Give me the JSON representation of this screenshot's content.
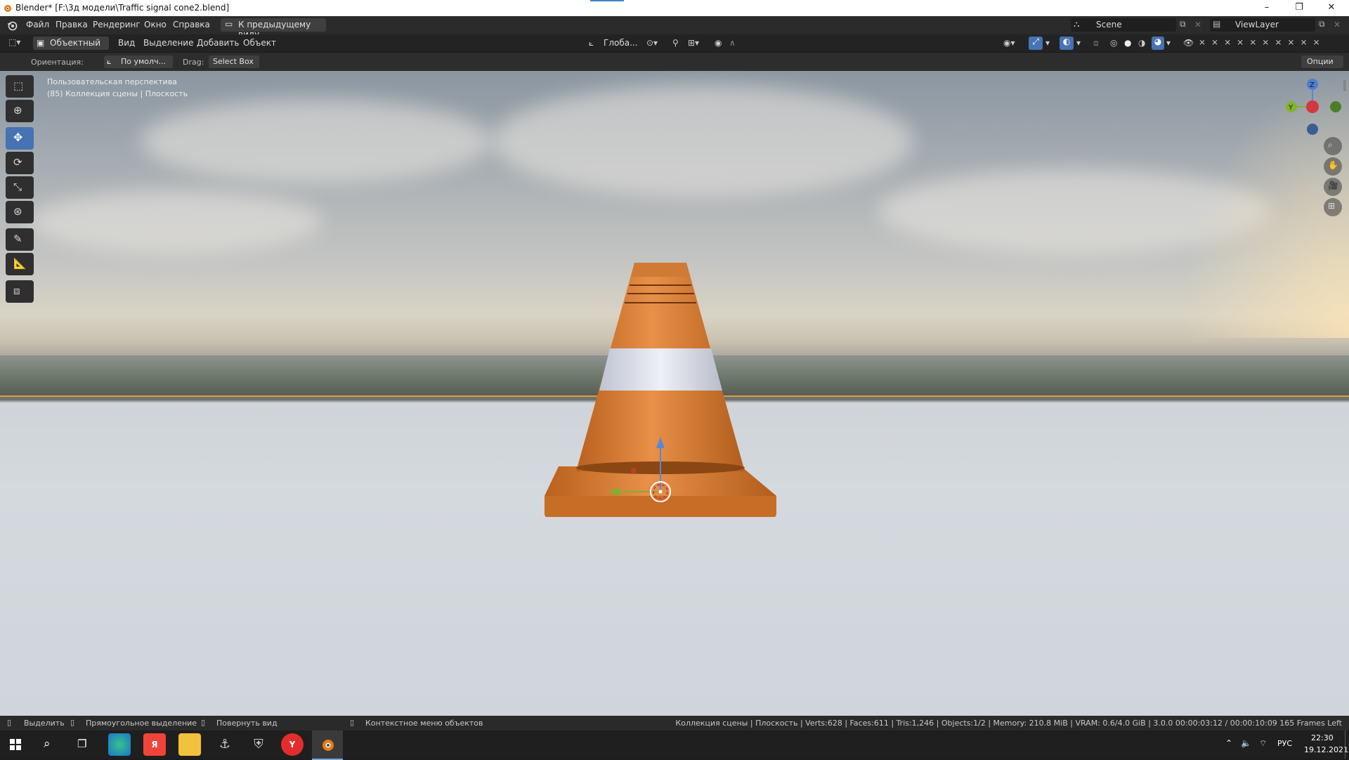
{
  "window": {
    "title": "Blender* [F:\\3д модели\\Traffic signal cone2.blend]",
    "minimize": "–",
    "maximize": "❐",
    "close": "✕"
  },
  "menu": {
    "items": [
      "Файл",
      "Правка",
      "Рендеринг",
      "Окно",
      "Справка"
    ],
    "back_button": "К предыдущему виду",
    "scene_label": "Scene",
    "viewlayer_label": "ViewLayer"
  },
  "header": {
    "mode": "Объектный ...",
    "menus": [
      "Вид",
      "Выделение",
      "Добавить",
      "Объект"
    ],
    "transform": "Глоба..."
  },
  "tool_options": {
    "orientation_label": "Ориентация:",
    "orientation_value": "По умолч...",
    "drag_label": "Drag:",
    "drag_value": "Select Box",
    "options_button": "Опции"
  },
  "viewport": {
    "overlay_line1": "Пользовательская перспектива",
    "overlay_line2": "(85) Коллекция сцены | Плоскость",
    "gizmo": {
      "x": "X",
      "y": "Y",
      "z": "Z"
    }
  },
  "tools": [
    "select-box-icon",
    "cursor-icon",
    "move-icon",
    "rotate-icon",
    "scale-icon",
    "transform-icon",
    "annotate-icon",
    "measure-icon",
    "add-cube-icon"
  ],
  "statusbar": {
    "select": "Выделить",
    "box_select": "Прямоугольное выделение",
    "rotate_view": "Повернуть вид",
    "context_menu": "Контекстное меню объектов",
    "stats": "Коллекция сцены | Плоскость | Verts:628 | Faces:611 | Tris:1,246 | Objects:1/2 | Memory: 210.8 MiB | VRAM: 0.6/4.0 GiB | 3.0.0  00:00:03:12 / 00:00:10:09  165 Frames Left"
  },
  "taskbar": {
    "lang": "РУС",
    "time": "22:30",
    "date": "19.12.2021"
  },
  "colors": {
    "accent": "#4772b3",
    "cone_orange": "#d9782b",
    "cone_stripe": "#d8dbe8",
    "horizon_line": "#e39c3c"
  }
}
